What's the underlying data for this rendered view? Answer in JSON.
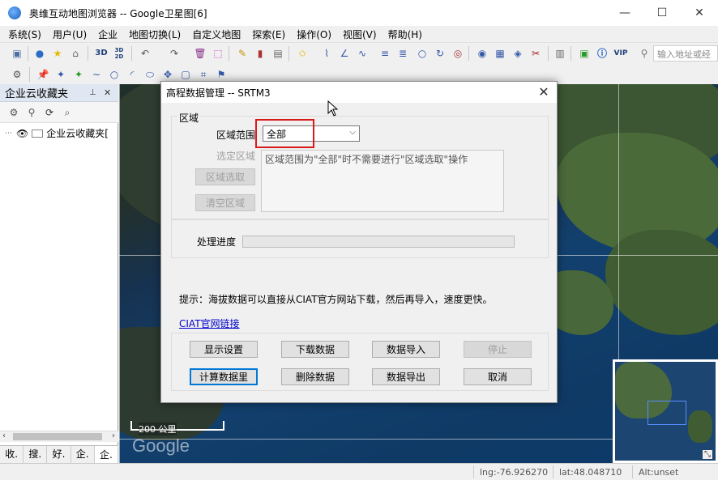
{
  "window": {
    "title": "奥维互动地图浏览器 -- Google卫星图[6]",
    "minimize": "—",
    "maximize": "☐",
    "close": "✕"
  },
  "menu": [
    "系统(S)",
    "用户(U)",
    "企业",
    "地图切换(L)",
    "自定义地图",
    "探索(E)",
    "操作(O)",
    "视图(V)",
    "帮助(H)"
  ],
  "toolbar": {
    "label_3d": "3D",
    "label_3d2d": "3D/2D",
    "label_vip": "VIP",
    "address_placeholder": "输入地址或经"
  },
  "left_panel": {
    "title": "企业云收藏夹",
    "pin": "ᵖ",
    "close": "✕",
    "tree_root": "企业云收藏夹[",
    "tabs": [
      "收.",
      "搜.",
      "好.",
      "企.",
      "企."
    ]
  },
  "map": {
    "scale_label": "200 公里",
    "watermark": "Google"
  },
  "status": {
    "lng": "lng:-76.926270",
    "lat": "lat:48.048710",
    "alt": "Alt:unset"
  },
  "dialog": {
    "title": "高程数据管理 -- SRTM3",
    "close": "✕",
    "group_region": "区域",
    "region_range_label": "区域范围",
    "region_range_value": "全部",
    "select_region_label": "选定区域",
    "region_select_button": "区域选取",
    "clear_region_button": "清空区域",
    "note": "区域范围为\"全部\"时不需要进行\"区域选取\"操作",
    "progress_label": "处理进度",
    "progress": 0,
    "tip": "提示：海拔数据可以直接从CIAT官方网站下载，然后再导入，速度更快。",
    "ciat_link": "CIAT官网链接",
    "buttons": {
      "display_settings": "显示设置",
      "download_data": "下载数据",
      "import_data": "数据导入",
      "stop": "停止",
      "calc_data": "计算数据里",
      "delete_data": "删除数据",
      "export_data": "数据导出",
      "cancel": "取消"
    }
  }
}
